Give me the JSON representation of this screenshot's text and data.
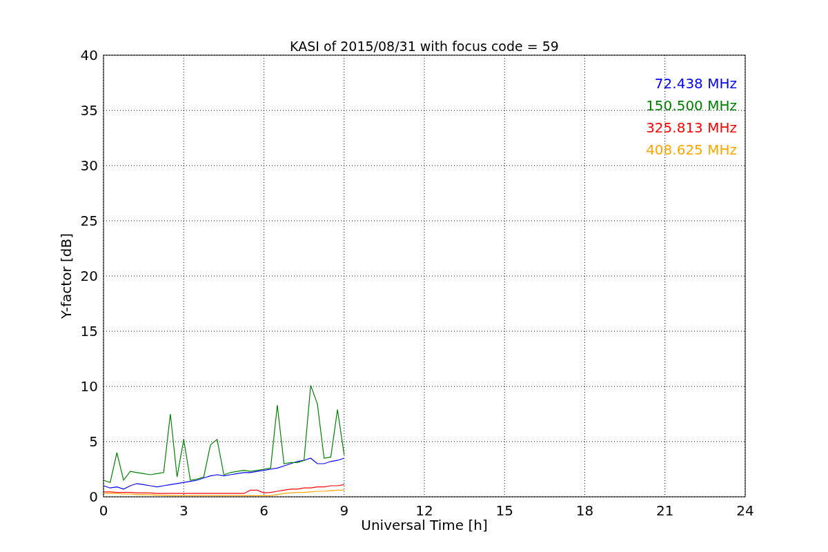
{
  "chart": {
    "chart_data": {
      "type": "line",
      "title": "KASI of 2015/08/31 with focus code = 59",
      "xlabel": "Universal Time [h]",
      "ylabel": "Y-factor [dB]",
      "x": [
        0,
        0.25,
        0.5,
        0.75,
        1,
        1.25,
        1.5,
        1.75,
        2,
        2.25,
        2.5,
        2.75,
        3,
        3.25,
        3.5,
        3.75,
        4,
        4.25,
        4.5,
        4.75,
        5,
        5.25,
        5.5,
        5.75,
        6,
        6.25,
        6.5,
        6.75,
        7,
        7.25,
        7.5,
        7.75,
        8,
        8.25,
        8.5,
        8.75,
        9
      ],
      "series": [
        {
          "name": "72.438 MHz",
          "color": "#0000ff",
          "values": [
            1.0,
            0.8,
            0.9,
            0.7,
            1.0,
            1.2,
            1.1,
            1.0,
            0.9,
            1.0,
            1.1,
            1.2,
            1.3,
            1.4,
            1.5,
            1.7,
            1.9,
            2.0,
            1.9,
            2.0,
            2.1,
            2.2,
            2.2,
            2.3,
            2.4,
            2.5,
            2.6,
            2.8,
            3.0,
            3.2,
            3.3,
            3.5,
            3.0,
            3.0,
            3.2,
            3.3,
            3.5
          ]
        },
        {
          "name": "150.500 MHz",
          "color": "#008000",
          "values": [
            1.5,
            1.3,
            4.0,
            1.5,
            2.3,
            2.2,
            2.1,
            2.0,
            2.1,
            2.2,
            7.5,
            1.8,
            5.2,
            1.5,
            1.6,
            1.8,
            4.7,
            5.2,
            2.0,
            2.2,
            2.3,
            2.4,
            2.3,
            2.4,
            2.5,
            2.6,
            8.3,
            3.0,
            3.1,
            3.1,
            3.3,
            10.1,
            8.4,
            3.5,
            3.6,
            7.9,
            3.8
          ]
        },
        {
          "name": "325.813 MHz",
          "color": "#ff0000",
          "values": [
            0.45,
            0.45,
            0.4,
            0.4,
            0.4,
            0.35,
            0.35,
            0.35,
            0.3,
            0.3,
            0.3,
            0.3,
            0.3,
            0.3,
            0.3,
            0.3,
            0.3,
            0.3,
            0.3,
            0.3,
            0.3,
            0.3,
            0.6,
            0.6,
            0.35,
            0.4,
            0.5,
            0.6,
            0.7,
            0.7,
            0.8,
            0.8,
            0.9,
            0.9,
            1.0,
            1.0,
            1.1
          ]
        },
        {
          "name": "408.625 MHz",
          "color": "#ffa500",
          "values": [
            0.3,
            0.3,
            0.3,
            0.25,
            0.25,
            0.2,
            0.2,
            0.2,
            0.15,
            0.15,
            0.1,
            0.1,
            0.1,
            0.1,
            0.1,
            0.1,
            0.1,
            0.1,
            0.1,
            0.1,
            0.1,
            0.1,
            0.1,
            0.1,
            0.1,
            0.1,
            0.2,
            0.3,
            0.35,
            0.4,
            0.4,
            0.45,
            0.5,
            0.5,
            0.55,
            0.6,
            0.6
          ]
        }
      ],
      "xlim": [
        0,
        24
      ],
      "ylim": [
        0,
        40
      ],
      "xticks": [
        0,
        3,
        6,
        9,
        12,
        15,
        18,
        21,
        24
      ],
      "yticks": [
        0,
        5,
        10,
        15,
        20,
        25,
        30,
        35,
        40
      ],
      "grid": true
    }
  }
}
